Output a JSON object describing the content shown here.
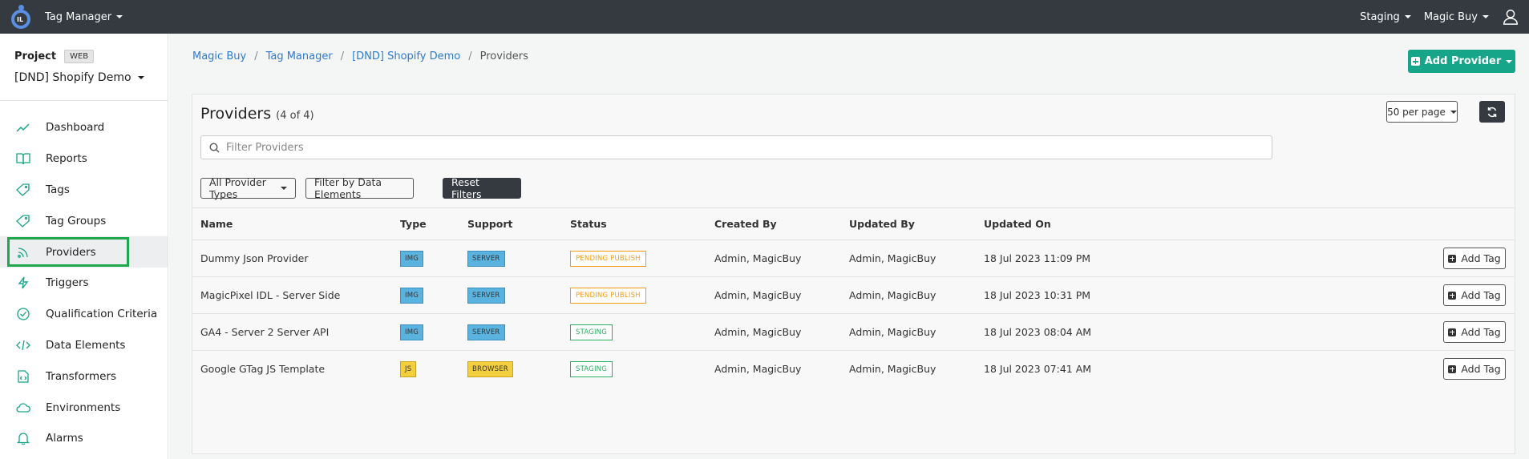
{
  "topbar": {
    "app_name": "Tag Manager",
    "env": "Staging",
    "org": "Magic Buy",
    "logo_text": "IL"
  },
  "sidebar": {
    "project_label": "Project",
    "project_badge": "WEB",
    "project_name": "[DND] Shopify Demo",
    "items": [
      {
        "label": "Dashboard",
        "icon": "trend-icon"
      },
      {
        "label": "Reports",
        "icon": "book-icon"
      },
      {
        "label": "Tags",
        "icon": "tag-icon"
      },
      {
        "label": "Tag Groups",
        "icon": "tag-icon"
      },
      {
        "label": "Providers",
        "icon": "rss-icon",
        "active": true
      },
      {
        "label": "Triggers",
        "icon": "bolt-icon"
      },
      {
        "label": "Qualification Criteria",
        "icon": "check-circle-icon"
      },
      {
        "label": "Data Elements",
        "icon": "code-icon"
      },
      {
        "label": "Transformers",
        "icon": "file-code-icon"
      },
      {
        "label": "Environments",
        "icon": "cloud-icon"
      },
      {
        "label": "Alarms",
        "icon": "bell-icon"
      }
    ]
  },
  "breadcrumb": {
    "items": [
      "Magic Buy",
      "Tag Manager",
      "[DND] Shopify Demo"
    ],
    "current": "Providers"
  },
  "add_provider_label": "Add Provider",
  "card": {
    "title": "Providers",
    "count": "(4 of 4)",
    "per_page": "50 per page",
    "search_placeholder": "Filter Providers",
    "filter_types": "All Provider Types",
    "filter_data_elements": "Filter by Data Elements",
    "reset_filters": "Reset Filters"
  },
  "table": {
    "headers": {
      "name": "Name",
      "type": "Type",
      "support": "Support",
      "status": "Status",
      "created_by": "Created By",
      "updated_by": "Updated By",
      "updated_on": "Updated On"
    },
    "rows": [
      {
        "name": "Dummy Json Provider",
        "type": "IMG",
        "support": "SERVER",
        "status": "PENDING PUBLISH",
        "created_by": "Admin, MagicBuy",
        "updated_by": "Admin, MagicBuy",
        "updated_on": "18 Jul 2023 11:09 PM",
        "action": "Add Tag"
      },
      {
        "name": "MagicPixel IDL - Server Side",
        "type": "IMG",
        "support": "SERVER",
        "status": "PENDING PUBLISH",
        "created_by": "Admin, MagicBuy",
        "updated_by": "Admin, MagicBuy",
        "updated_on": "18 Jul 2023 10:31 PM",
        "action": "Add Tag"
      },
      {
        "name": "GA4 - Server 2 Server API",
        "type": "IMG",
        "support": "SERVER",
        "status": "STAGING",
        "created_by": "Admin, MagicBuy",
        "updated_by": "Admin, MagicBuy",
        "updated_on": "18 Jul 2023 08:04 AM",
        "action": "Add Tag"
      },
      {
        "name": "Google GTag JS Template",
        "type": "JS",
        "support": "BROWSER",
        "status": "STAGING",
        "created_by": "Admin, MagicBuy",
        "updated_by": "Admin, MagicBuy",
        "updated_on": "18 Jul 2023 07:41 AM",
        "action": "Add Tag"
      }
    ]
  },
  "colors": {
    "topbar": "#343a40",
    "accent": "#17a589",
    "link": "#2b7bd4",
    "highlight": "#1fa74c",
    "badge_blue": "#5ab3df",
    "badge_yellow": "#f3cf3e",
    "pending": "#f39c12",
    "staging": "#27ae60"
  }
}
